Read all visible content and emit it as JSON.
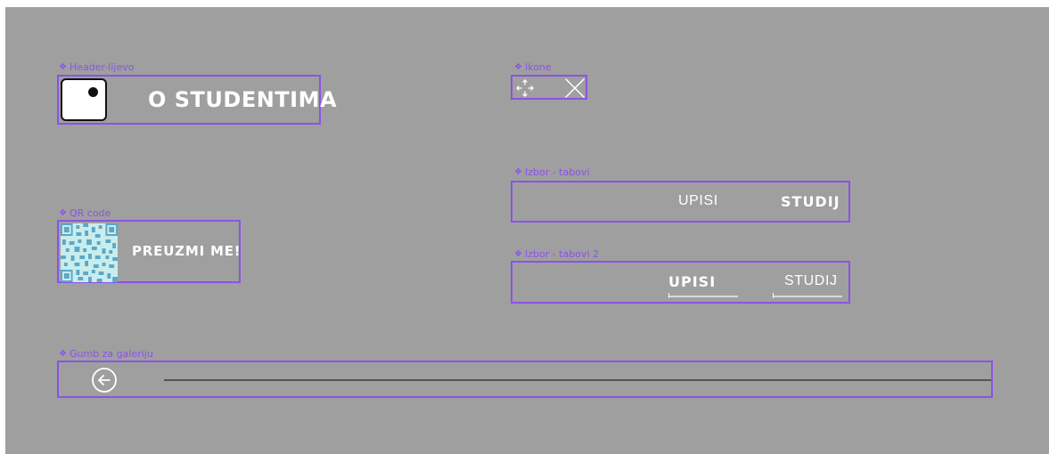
{
  "components": {
    "header": {
      "label": "Header-lijevo",
      "title": "O STUDENTIMA"
    },
    "icons": {
      "label": "Ikone",
      "items": [
        "move-icon",
        "close-icon"
      ]
    },
    "tabs1": {
      "label": "Izbor - tabovi",
      "tab_a": "UPISI",
      "tab_b": "STUDIJ",
      "active": "STUDIJ"
    },
    "tabs2": {
      "label": "Izbor - tabovi 2",
      "tab_a": "UPISI",
      "tab_b": "STUDIJ",
      "active": "UPISI"
    },
    "qr": {
      "label": "QR code",
      "text": "PREUZMI ME!"
    },
    "gallery": {
      "label": "Gumb za galeriju",
      "icon": "arrow-left-circle-icon"
    }
  },
  "colors": {
    "canvas": "#9f9f9f",
    "component_outline": "#8c52e6",
    "text": "#ffffff"
  }
}
